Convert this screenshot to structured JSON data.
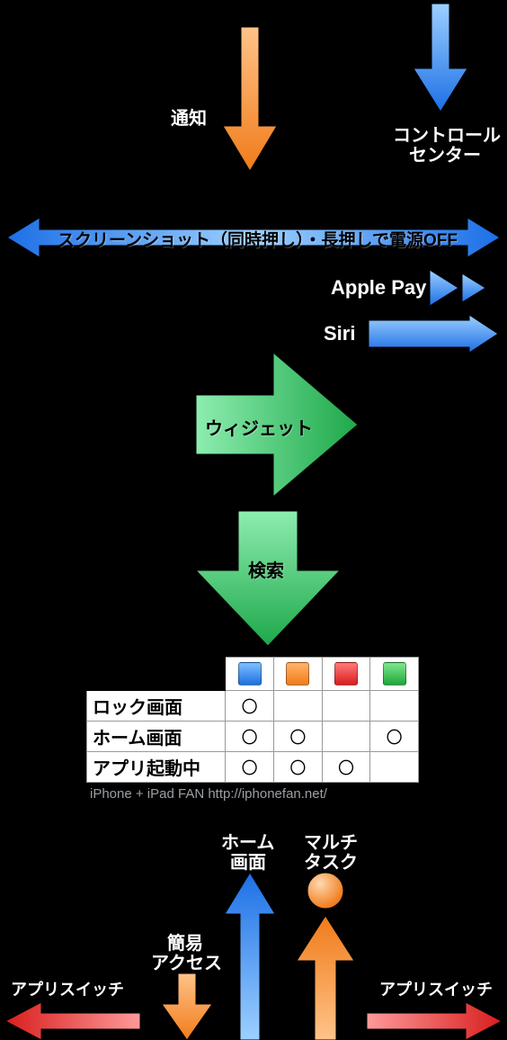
{
  "labels": {
    "notify": "通知",
    "control_center_l1": "コントロール",
    "control_center_l2": "センター",
    "screenshot_bar": "スクリーンショット（同時押し）・長押しで電源OFF",
    "apple_pay": "Apple Pay",
    "siri": "Siri",
    "widget": "ウィジェット",
    "search": "検索",
    "home_l1": "ホーム",
    "home_l2": "画面",
    "multi_l1": "マルチ",
    "multi_l2": "タスク",
    "easy_l1": "簡易",
    "easy_l2": "アクセス",
    "app_switch_left": "アプリスイッチ",
    "app_switch_right": "アプリスイッチ"
  },
  "table": {
    "row_headers": [
      "ロック画面",
      "ホーム画面",
      "アプリ起動中"
    ],
    "col_colors": [
      "blue",
      "orange",
      "red",
      "green"
    ],
    "cells": [
      [
        "〇",
        "",
        "",
        ""
      ],
      [
        "〇",
        "〇",
        "",
        "〇"
      ],
      [
        "〇",
        "〇",
        "〇",
        ""
      ]
    ],
    "attribution": "iPhone + iPad FAN  http://iphonefan.net/"
  },
  "chart_data": {
    "type": "table",
    "title": "iPhone gesture / button diagram",
    "row_labels": [
      "ロック画面",
      "ホーム画面",
      "アプリ起動中"
    ],
    "column_colors": [
      "blue",
      "orange",
      "red",
      "green"
    ],
    "matrix": [
      [
        1,
        0,
        0,
        0
      ],
      [
        1,
        1,
        0,
        1
      ],
      [
        1,
        1,
        1,
        0
      ]
    ],
    "gestures": [
      {
        "name": "通知",
        "color": "orange",
        "direction": "down"
      },
      {
        "name": "コントロールセンター",
        "color": "blue",
        "direction": "down"
      },
      {
        "name": "スクリーンショット（同時押し）・長押しで電源OFF",
        "color": "blue",
        "direction": "left-right"
      },
      {
        "name": "Apple Pay",
        "color": "blue",
        "direction": "double-right"
      },
      {
        "name": "Siri",
        "color": "blue",
        "direction": "right"
      },
      {
        "name": "ウィジェット",
        "color": "green",
        "direction": "right"
      },
      {
        "name": "検索",
        "color": "green",
        "direction": "down"
      },
      {
        "name": "ホーム画面",
        "color": "blue",
        "direction": "up"
      },
      {
        "name": "マルチタスク",
        "color": "orange",
        "direction": "up-stop"
      },
      {
        "name": "簡易アクセス",
        "color": "orange",
        "direction": "down"
      },
      {
        "name": "アプリスイッチ",
        "color": "red",
        "direction": "left"
      },
      {
        "name": "アプリスイッチ",
        "color": "red",
        "direction": "right"
      }
    ]
  }
}
